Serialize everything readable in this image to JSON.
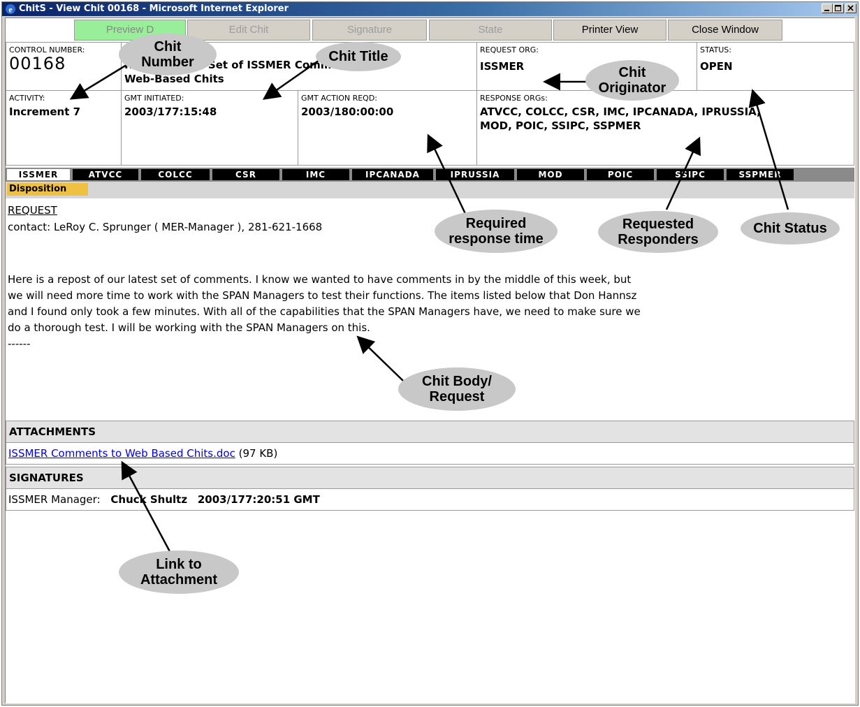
{
  "window": {
    "title": "ChitS - View Chit 00168 - Microsoft Internet Explorer"
  },
  "toolbar": {
    "buttons": [
      {
        "label": "Preview D",
        "state": "disabled"
      },
      {
        "label": "Edit Chit",
        "state": "disabled"
      },
      {
        "label": "Signature",
        "state": "disabled"
      },
      {
        "label": "State",
        "state": "disabled"
      },
      {
        "label": "Printer View",
        "state": "enabled"
      },
      {
        "label": "Close Window",
        "state": "enabled"
      }
    ]
  },
  "header": {
    "control_number_label": "CONTROL NUMBER:",
    "control_number": "00168",
    "subject_label": "SU",
    "subject_line1": "Repost of 3rd Set of ISSMER Comments to",
    "subject_line2": "Web-Based Chits",
    "request_org_label": "REQUEST ORG:",
    "request_org": "ISSMER",
    "status_label": "STATUS:",
    "status": "OPEN",
    "activity_label": "ACTIVITY:",
    "activity": "Increment 7",
    "gmt_initiated_label": "GMT INITIATED:",
    "gmt_initiated": "2003/177:15:48",
    "gmt_action_label": "GMT ACTION REQD:",
    "gmt_action": "2003/180:00:00",
    "response_orgs_label": "RESPONSE ORGs:",
    "response_orgs_line1": "ATVCC, COLCC, CSR, IMC, IPCANADA, IPRUSSIA,",
    "response_orgs_line2": "MOD, POIC, SSIPC, SSPMER"
  },
  "tabs": [
    "ISSMER",
    "ATVCC",
    "COLCC",
    "CSR",
    "IMC",
    "IPCANADA",
    "IPRUSSIA",
    "MOD",
    "POIC",
    "SSIPC",
    "SSPMER"
  ],
  "active_tab": "ISSMER",
  "disposition_label": "Disposition",
  "body": {
    "request_label": "REQUEST",
    "contact": "contact: LeRoy C. Sprunger ( MER-Manager ), 281-621-1668",
    "line1": "Here is a repost of our latest set of comments. I know we wanted to have comments in by the middle of this week, but",
    "line2": "we will need more time to work with the SPAN Managers to test their functions. The items listed below that Don Hannsz",
    "line3": "and I found only took a few minutes. With all of the capabilities that the SPAN Managers have, we need to make sure we",
    "line4": "do a thorough test. I will be working with the SPAN Managers on this.",
    "line5": "------"
  },
  "attachments": {
    "header": "ATTACHMENTS",
    "file_name": "ISSMER Comments to Web Based Chits.doc",
    "file_size": "(97 KB)"
  },
  "signatures": {
    "header": "SIGNATURES",
    "role": "ISSMER Manager:",
    "name": "Chuck Shultz",
    "time": "2003/177:20:51 GMT"
  },
  "callouts": {
    "chit_number": [
      "Chit",
      "Number"
    ],
    "chit_title": [
      "Chit Title"
    ],
    "chit_originator": [
      "Chit",
      "Originator"
    ],
    "required_response": [
      "Required",
      "response time"
    ],
    "requested_responders": [
      "Requested",
      "Responders"
    ],
    "chit_status": [
      "Chit Status"
    ],
    "chit_body": [
      "Chit Body/",
      "Request"
    ],
    "link_attachment": [
      "Link to",
      "Attachment"
    ]
  },
  "colors": {
    "titlebar_start": "#0a246a",
    "tab_black": "#000000",
    "disposition": "#f0c040",
    "preview_green": "#99ee99",
    "link": "#0000ee",
    "callout": "#c8c8c8"
  }
}
